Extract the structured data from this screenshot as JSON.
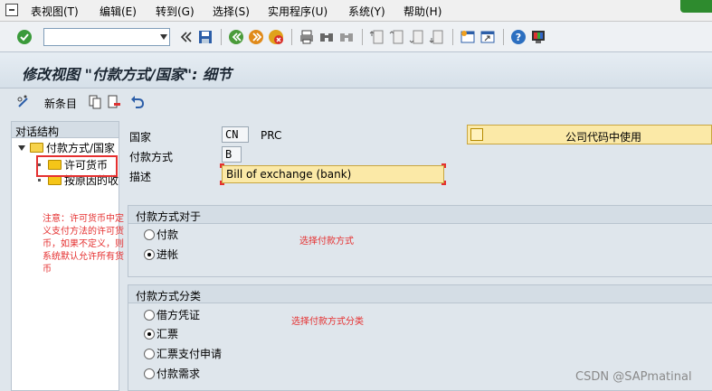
{
  "menu": [
    "表视图(T)",
    "编辑(E)",
    "转到(G)",
    "选择(S)",
    "实用程序(U)",
    "系统(Y)",
    "帮助(H)"
  ],
  "toolbar": {
    "command_value": "",
    "icons": [
      "enter-icon",
      "save-icon",
      "back-icon",
      "exit-icon",
      "cancel-icon",
      "print-icon",
      "find-icon",
      "find-next-icon",
      "first-page-icon",
      "previous-page-icon",
      "next-page-icon",
      "last-page-icon",
      "new-session-icon",
      "shortcut-icon",
      "help-icon",
      "customize-layout-icon"
    ]
  },
  "title": "修改视图 \"付款方式/国家\": 细节",
  "app_toolbar": {
    "new_entries_label": "新条目"
  },
  "tree": {
    "header": "对话结构",
    "items": [
      "付款方式/国家",
      "许可货币",
      "按原因的收"
    ]
  },
  "annotation_left": "注意：许可货币中定义支付方法的许可货币，如果不定义，则系统默认允许所有货币",
  "fields": {
    "country_label": "国家",
    "country_value": "CN",
    "country_name": "PRC",
    "payment_method_label": "付款方式",
    "payment_method_value": "B",
    "description_label": "描述",
    "description_value": "Bill of exchange (bank)"
  },
  "company_code_button": "公司代码中使用",
  "group1": {
    "title": "付款方式对于",
    "options": [
      "付款",
      "进帐"
    ],
    "selected": 1,
    "annotation": "选择付款方式"
  },
  "group2": {
    "title": "付款方式分类",
    "options": [
      "借方凭证",
      "汇票",
      "汇票支付申请",
      "付款需求"
    ],
    "selected": 1,
    "annotation": "选择付款方式分类"
  },
  "watermark": "CSDN @SAPmatinal",
  "colors": {
    "input_yellow": "#fbe9a7",
    "highlight_red": "#e53030"
  }
}
